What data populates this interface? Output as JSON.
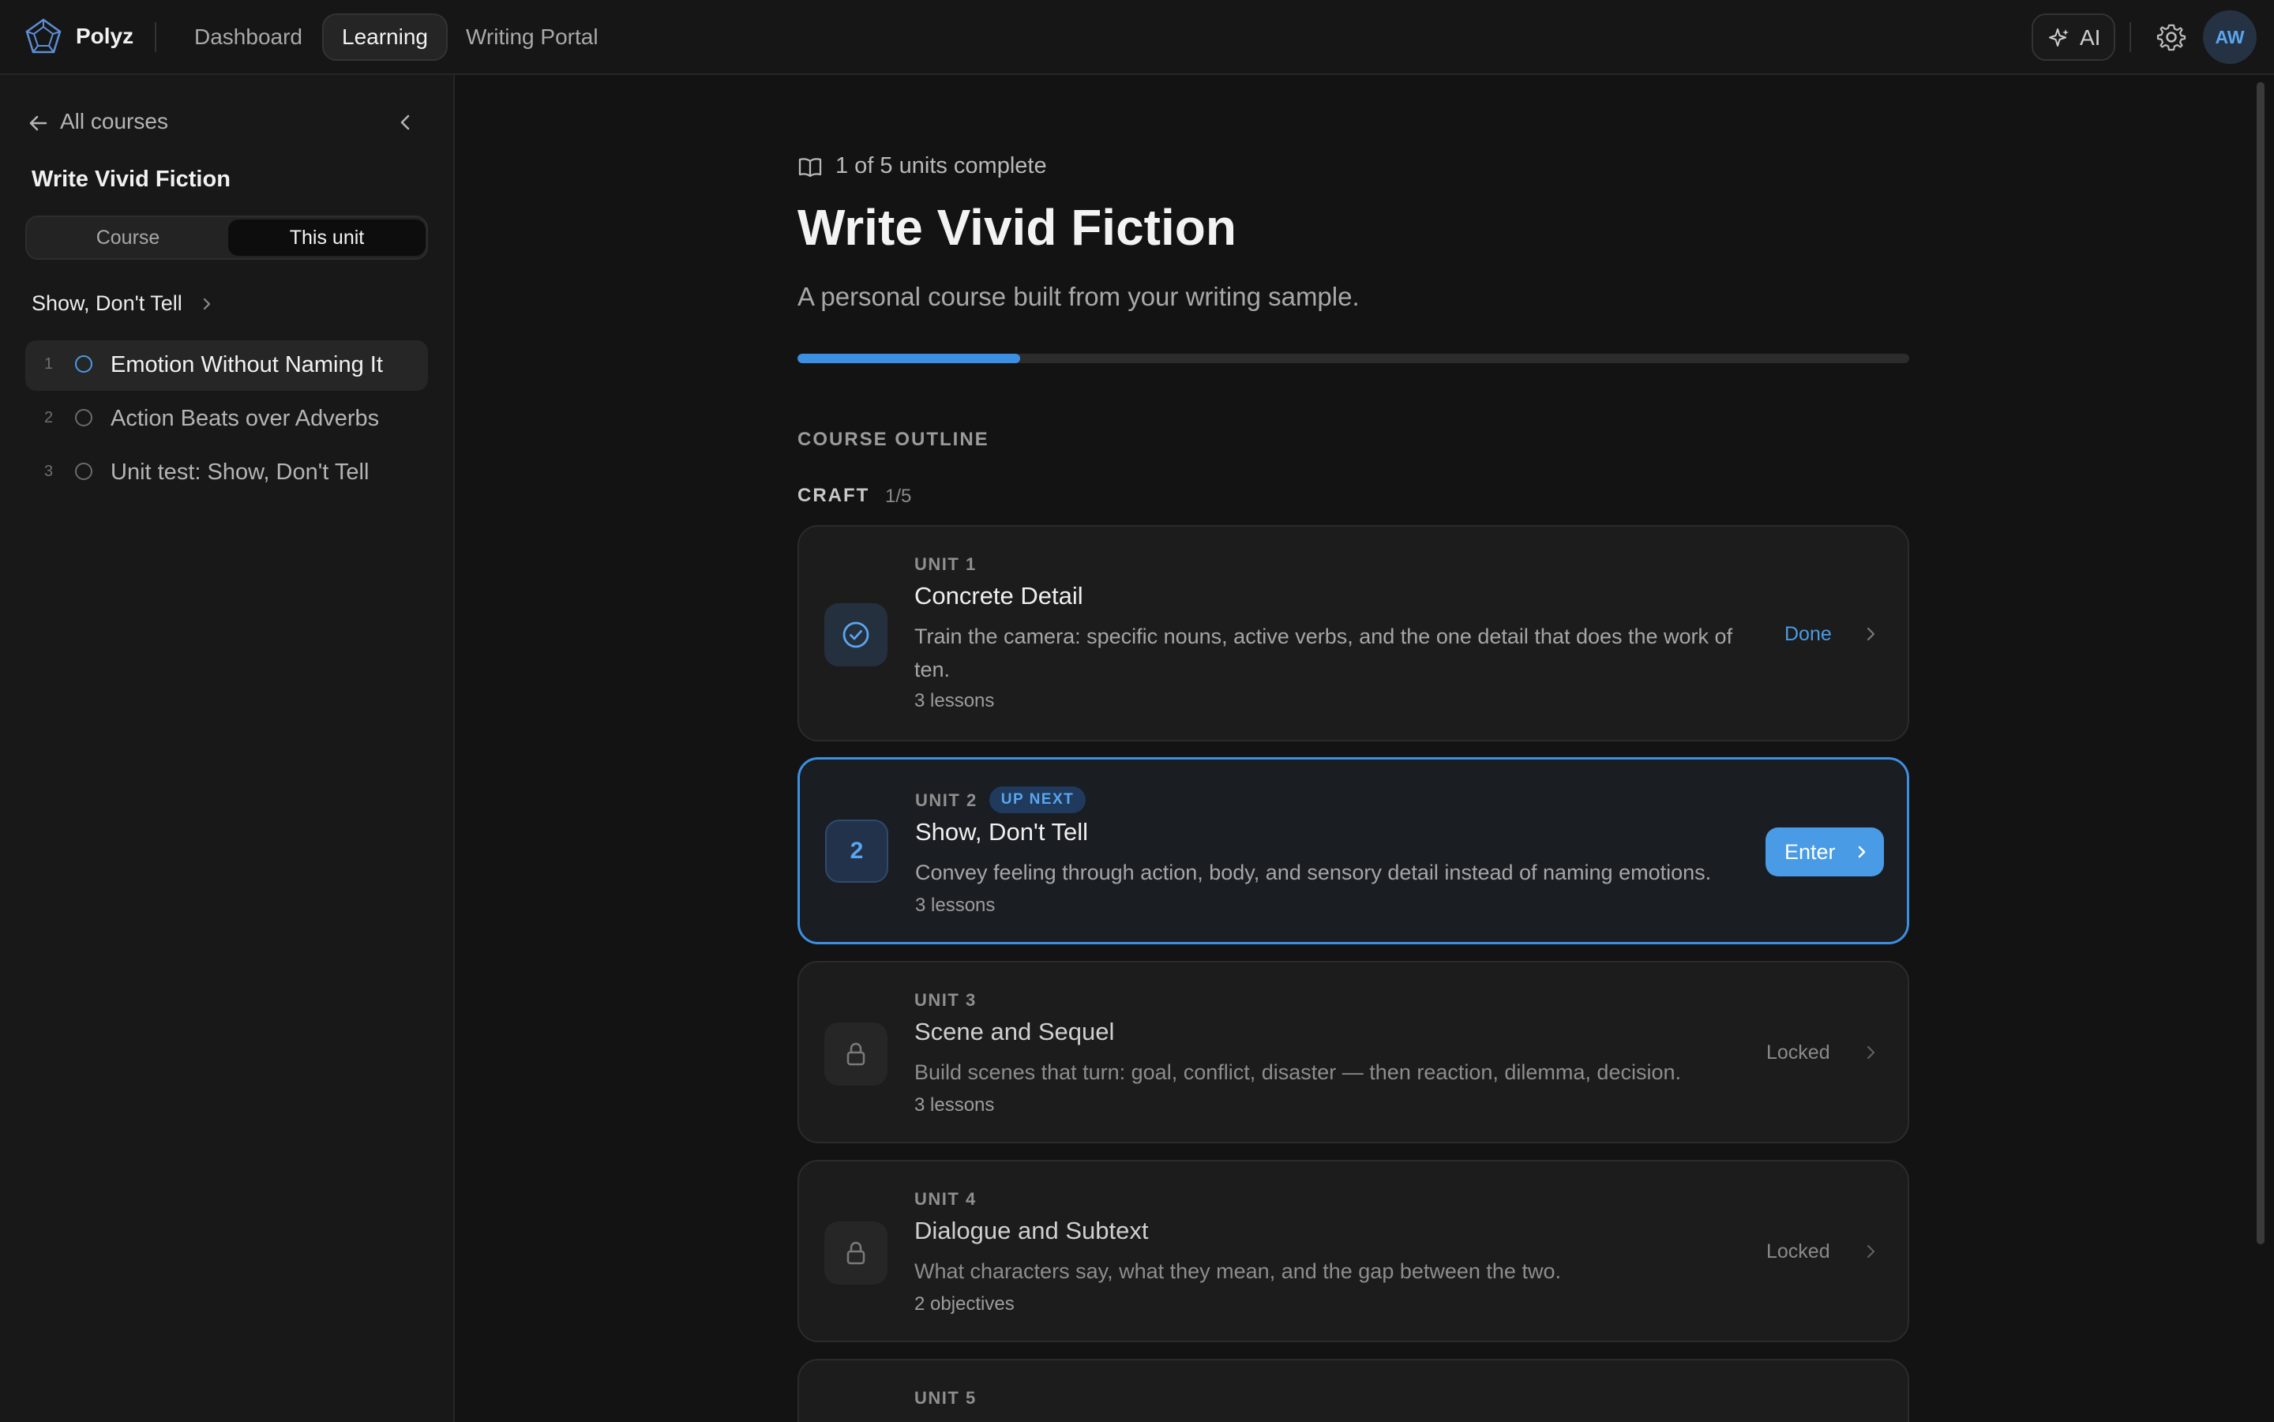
{
  "app": {
    "brand": "Polyz",
    "nav": [
      {
        "label": "Dashboard",
        "active": false
      },
      {
        "label": "Learning",
        "active": true
      },
      {
        "label": "Writing Portal",
        "active": false
      }
    ],
    "ai_label": "AI",
    "avatar_initials": "AW",
    "accent_color": "#4a9be6"
  },
  "sidebar": {
    "back_label": "All courses",
    "course_title": "Write Vivid Fiction",
    "segments": [
      {
        "label": "Course",
        "selected": false
      },
      {
        "label": "This unit",
        "selected": true
      }
    ],
    "unit_name": "Show, Don't Tell",
    "lessons": [
      {
        "num": "1",
        "label": "Emotion Without Naming It",
        "active": true
      },
      {
        "num": "2",
        "label": "Action Beats over Adverbs",
        "active": false
      },
      {
        "num": "3",
        "label": "Unit test: Show, Don't Tell",
        "active": false
      }
    ]
  },
  "main": {
    "progress_text": "1 of 5 units complete",
    "progress_fraction": 0.2,
    "title": "Write Vivid Fiction",
    "subtitle": "A personal course built from your writing sample.",
    "outline_label": "COURSE OUTLINE",
    "group": {
      "label": "CRAFT",
      "count": "1/5"
    },
    "units": [
      {
        "name": "UNIT 1",
        "title": "Concrete Detail",
        "desc": "Train the camera: specific nouns, active verbs, and the one detail that does the work of ten.",
        "count": "3 lessons",
        "status": "Done"
      },
      {
        "name": "UNIT 2",
        "badge": "UP NEXT",
        "number": "2",
        "title": "Show, Don't Tell",
        "desc": "Convey feeling through action, body, and sensory detail instead of naming emotions.",
        "count": "3 lessons",
        "action": "Enter"
      },
      {
        "name": "UNIT 3",
        "title": "Scene and Sequel",
        "desc": "Build scenes that turn: goal, conflict, disaster — then reaction, dilemma, decision.",
        "count": "3 lessons",
        "status": "Locked"
      },
      {
        "name": "UNIT 4",
        "title": "Dialogue and Subtext",
        "desc": "What characters say, what they mean, and the gap between the two.",
        "count": "2 objectives",
        "status": "Locked"
      },
      {
        "name": "UNIT 5"
      }
    ]
  }
}
